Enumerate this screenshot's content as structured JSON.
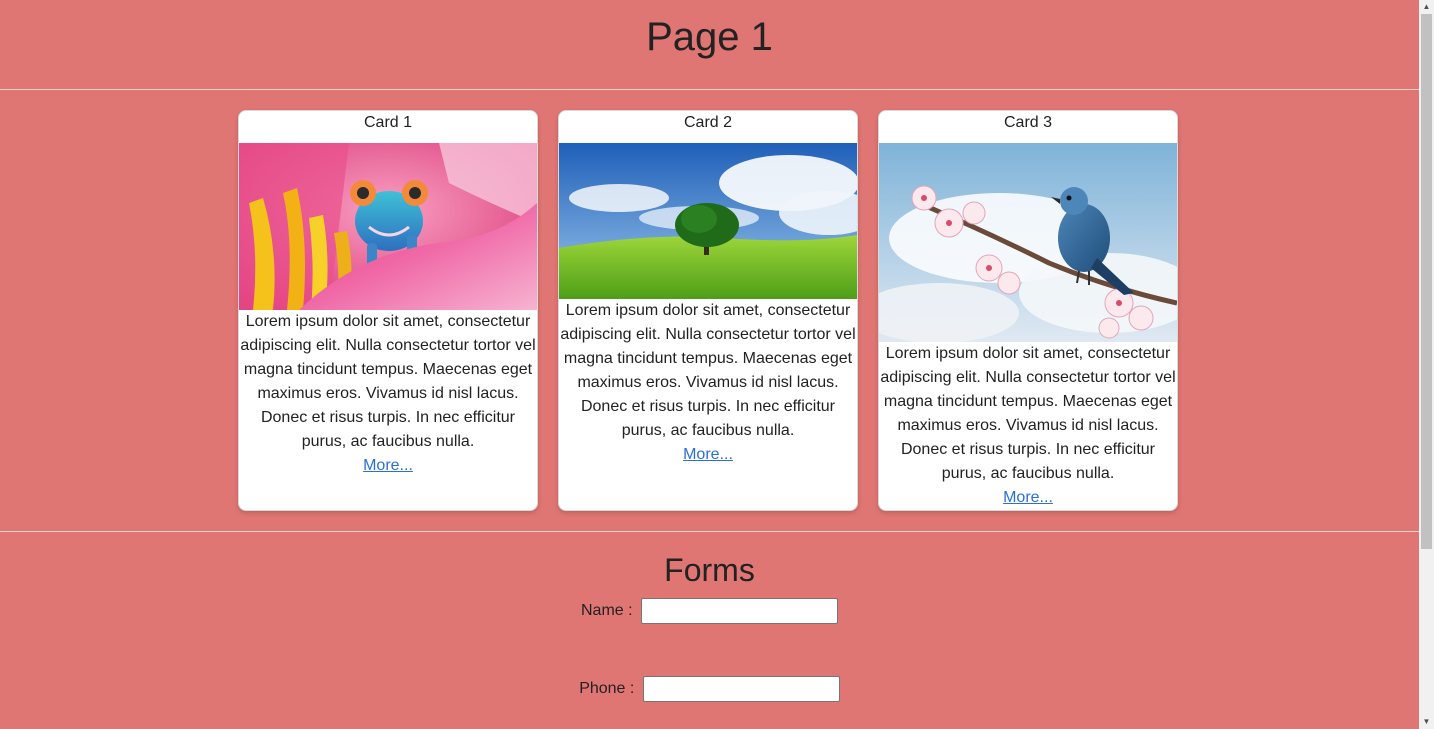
{
  "page": {
    "title": "Page 1"
  },
  "cards": [
    {
      "title": "Card 1",
      "image": "chameleon-on-flower",
      "text": "Lorem ipsum dolor sit amet, consectetur adipiscing elit. Nulla consectetur tortor vel magna tincidunt tempus. Maecenas eget maximus eros. Vivamus id nisl lacus. Donec et risus turpis. In nec efficitur purus, ac faucibus nulla.",
      "link": "More..."
    },
    {
      "title": "Card 2",
      "image": "tree-on-green-hill",
      "text": "Lorem ipsum dolor sit amet, consectetur adipiscing elit. Nulla consectetur tortor vel magna tincidunt tempus. Maecenas eget maximus eros. Vivamus id nisl lacus. Donec et risus turpis. In nec efficitur purus, ac faucibus nulla.",
      "link": "More..."
    },
    {
      "title": "Card 3",
      "image": "bluebird-on-blossom-branch",
      "text": "Lorem ipsum dolor sit amet, consectetur adipiscing elit. Nulla consectetur tortor vel magna tincidunt tempus. Maecenas eget maximus eros. Vivamus id nisl lacus. Donec et risus turpis. In nec efficitur purus, ac faucibus nulla.",
      "link": "More..."
    }
  ],
  "forms": {
    "title": "Forms",
    "name_label": "Name :",
    "name_value": "",
    "phone_label": "Phone :",
    "phone_value": ""
  },
  "colors": {
    "background": "#e07674",
    "card": "#ffffff",
    "link": "#2a6fd6"
  }
}
